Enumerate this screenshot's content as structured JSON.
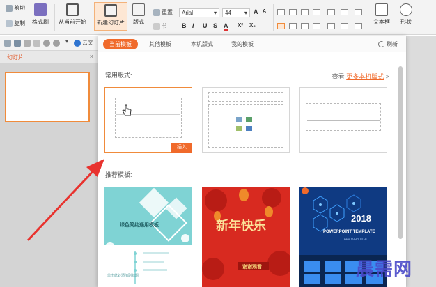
{
  "ribbon": {
    "cut_label": "剪切",
    "copy_label": "复制",
    "format_painter_label": "格式刷",
    "from_current_label": "从当前开始",
    "new_slide_label": "新建幻灯片",
    "layout_label": "版式",
    "section_label": "节",
    "reset_label": "重置",
    "font_name": "Arial",
    "font_size": "44",
    "increase_font": "A",
    "decrease_font": "A",
    "bold": "B",
    "italic": "I",
    "underline": "U",
    "strike": "S",
    "font_color": "A",
    "superscript": "X²",
    "subscript": "X₂",
    "textbox_label": "文本框",
    "shape_label": "形状"
  },
  "quickbar": {
    "cloud_label": "云文"
  },
  "left_pane": {
    "tab_label": "幻灯片",
    "close_label": "×"
  },
  "panel": {
    "tabs": [
      {
        "label": "当前模板",
        "active": true
      },
      {
        "label": "其他模板",
        "active": false
      },
      {
        "label": "本机版式",
        "active": false
      },
      {
        "label": "我的模板",
        "active": false
      }
    ],
    "refresh_label": "刷新",
    "common_layouts_title": "常用版式:",
    "view_prefix": "查看",
    "view_link": "更多本机版式",
    "view_suffix": ">",
    "insert_label": "插入",
    "recommended_title": "推荐模板:",
    "templates": [
      {
        "title": "绿色简约通用模板",
        "caption": "单击此处添加副标题"
      },
      {
        "title": "新年快乐",
        "caption": "谢谢观看"
      },
      {
        "year": "2018",
        "title": "POWERPOINT TEMPLATE",
        "subtitle": "ADD YOUR TITLE"
      }
    ]
  },
  "watermark": "晨需网",
  "colors": {
    "accent": "#f06a2b",
    "teal": "#7fd3d4",
    "red": "#d82a20",
    "navy": "#0b2e66"
  }
}
